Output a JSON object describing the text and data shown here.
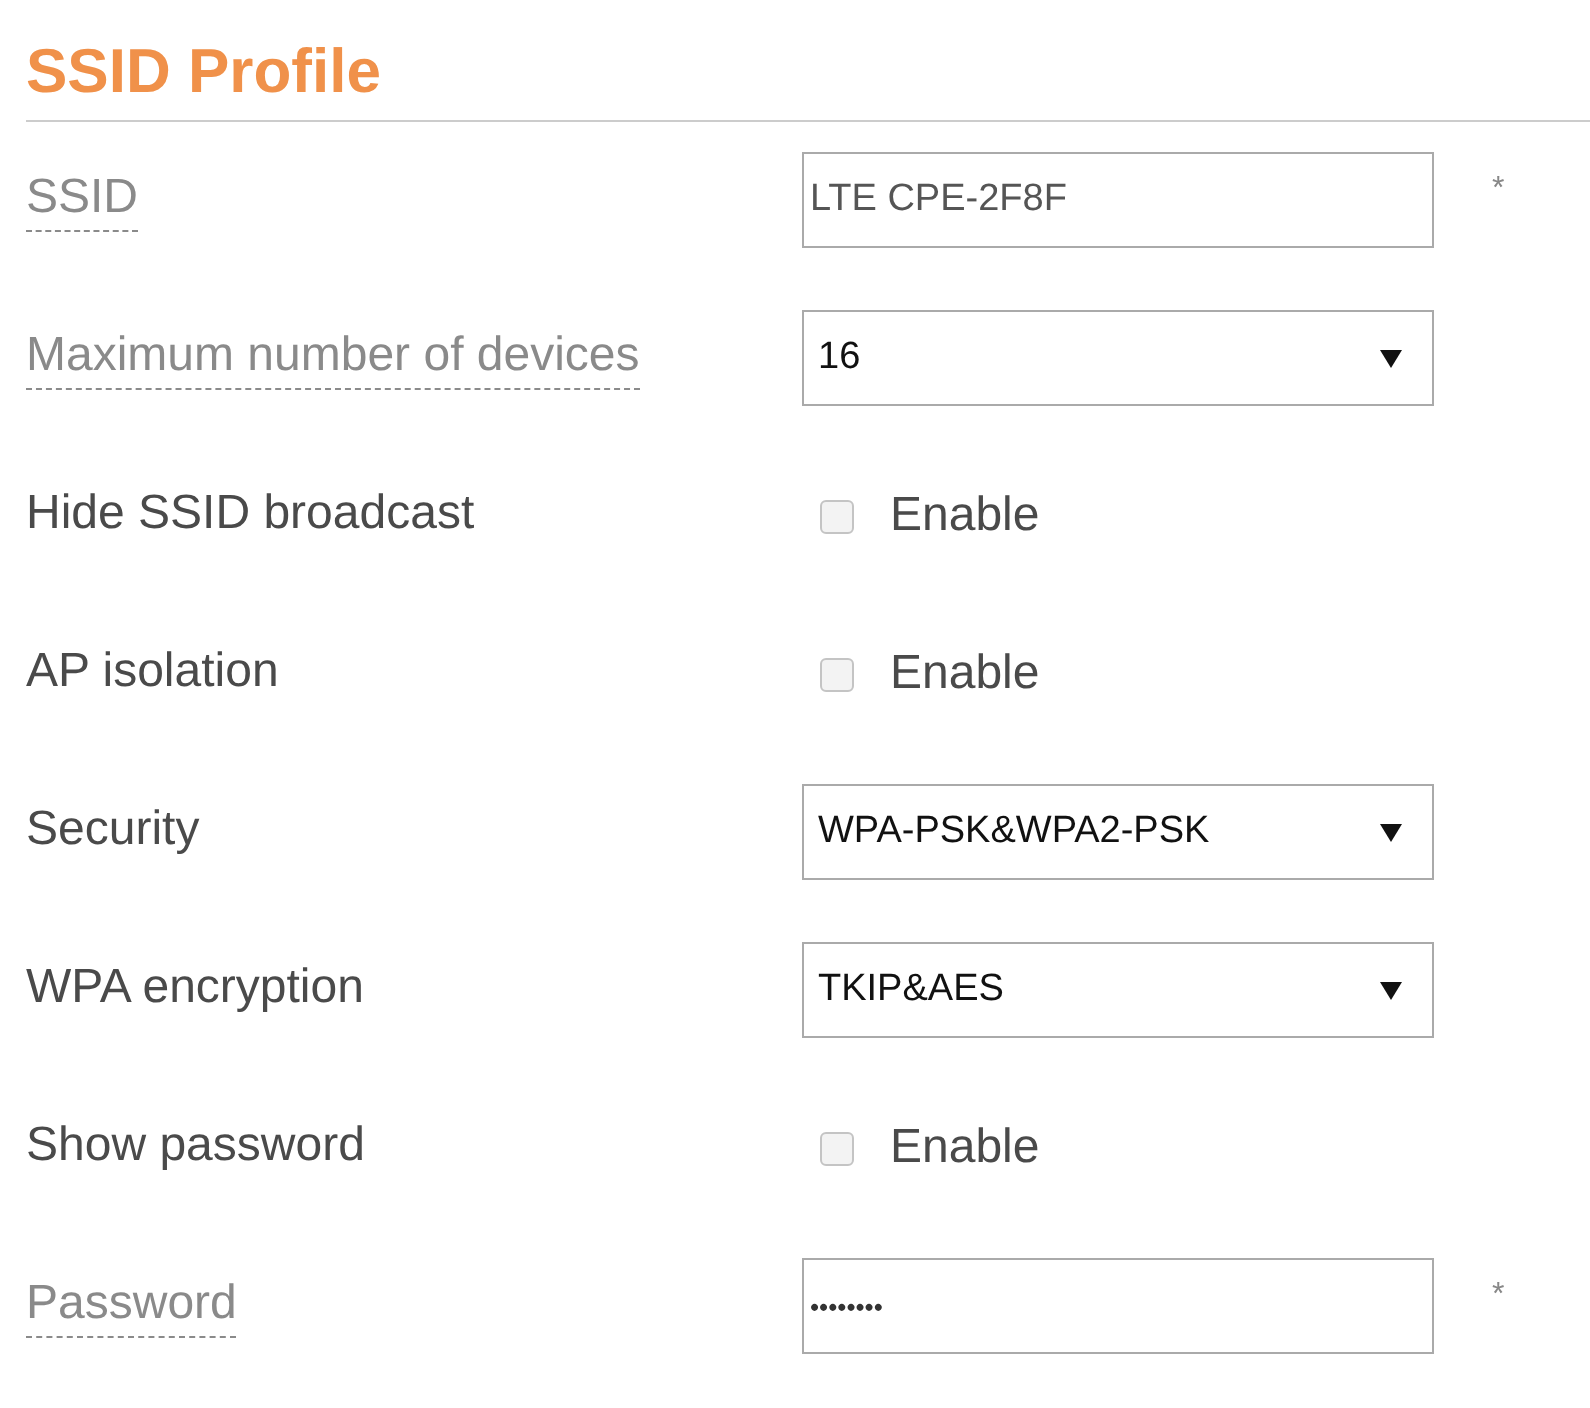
{
  "title": "SSID Profile",
  "rows": [
    {
      "label": "SSID",
      "underlined": true,
      "kind": "text",
      "value": "LTE CPE-2F8F",
      "required": "*"
    },
    {
      "label": "Maximum number of devices",
      "underlined": true,
      "kind": "select",
      "value": "16"
    },
    {
      "label": "Hide SSID broadcast",
      "underlined": false,
      "kind": "checkbox",
      "checked": false,
      "option": "Enable"
    },
    {
      "label": "AP isolation",
      "underlined": false,
      "kind": "checkbox",
      "checked": false,
      "option": "Enable"
    },
    {
      "label": "Security",
      "underlined": false,
      "kind": "select",
      "value": "WPA-PSK&WPA2-PSK"
    },
    {
      "label": "WPA encryption",
      "underlined": false,
      "kind": "select",
      "value": "TKIP&AES"
    },
    {
      "label": "Show password",
      "underlined": false,
      "kind": "checkbox",
      "checked": false,
      "option": "Enable"
    },
    {
      "label": "Password",
      "underlined": true,
      "kind": "password",
      "value": "••••••••",
      "required": "*"
    }
  ]
}
